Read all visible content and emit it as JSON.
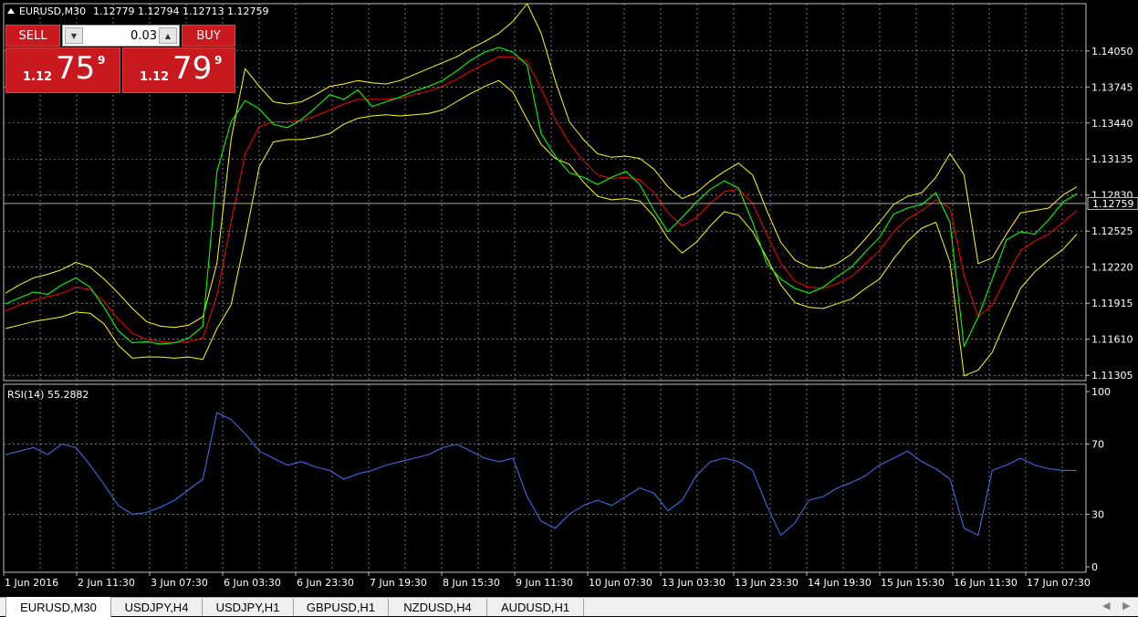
{
  "window": {
    "symbol_header": "EURUSD,M30",
    "ohlc": "1.12779 1.12794 1.12713 1.12759",
    "current_price": "1.12759"
  },
  "one_click": {
    "sell_label": "SELL",
    "buy_label": "BUY",
    "volume": "0.03",
    "sell_prefix": "1.12",
    "sell_big": "75",
    "sell_sup": "9",
    "buy_prefix": "1.12",
    "buy_big": "79",
    "buy_sup": "9"
  },
  "indicator": {
    "label": "RSI(14) 55.2882"
  },
  "tabs": [
    {
      "label": "EURUSD,M30",
      "active": true
    },
    {
      "label": "USDJPY,H4",
      "active": false
    },
    {
      "label": "USDJPY,H1",
      "active": false
    },
    {
      "label": "GBPUSD,H1",
      "active": false
    },
    {
      "label": "NZDUSD,H4",
      "active": false
    },
    {
      "label": "AUDUSD,H1",
      "active": false
    }
  ],
  "colors": {
    "background": "#000000",
    "grid": "#c0c0c0",
    "price_line": "#00ff00",
    "moving_average": "#ff0000",
    "bands": "#ffff00",
    "rsi": "#4169e1",
    "text": "#ffffff",
    "sell_buy_panel": "#c8191f"
  },
  "chart_data": [
    {
      "type": "line",
      "title": "EURUSD,M30",
      "y_ticks": [
        "1.14050",
        "1.13745",
        "1.13440",
        "1.13135",
        "1.12830",
        "1.12525",
        "1.12220",
        "1.11915",
        "1.11610",
        "1.11305"
      ],
      "ylim": [
        1.1126,
        1.1445
      ],
      "x_ticks": [
        "1 Jun 2016",
        "2 Jun 11:30",
        "3 Jun 07:30",
        "6 Jun 03:30",
        "6 Jun 23:30",
        "7 Jun 19:30",
        "8 Jun 15:30",
        "9 Jun 11:30",
        "10 Jun 07:30",
        "13 Jun 03:30",
        "13 Jun 23:30",
        "14 Jun 19:30",
        "15 Jun 15:30",
        "16 Jun 11:30",
        "17 Jun 07:30"
      ],
      "current_price": 1.12759,
      "series": [
        {
          "values": [
            1.1191,
            1.1196,
            1.1201,
            1.1199,
            1.1207,
            1.1213,
            1.1205,
            1.1188,
            1.1168,
            1.1158,
            1.1159,
            1.1157,
            1.1158,
            1.1162,
            1.1172,
            1.1303,
            1.1345,
            1.1363,
            1.1356,
            1.1343,
            1.134,
            1.1347,
            1.1357,
            1.1368,
            1.1364,
            1.1372,
            1.1358,
            1.1362,
            1.1366,
            1.1371,
            1.1375,
            1.138,
            1.1388,
            1.1397,
            1.1404,
            1.1408,
            1.1404,
            1.1393,
            1.1335,
            1.1316,
            1.1302,
            1.1298,
            1.1292,
            1.1298,
            1.1303,
            1.1292,
            1.127,
            1.1252,
            1.1264,
            1.1277,
            1.1288,
            1.1295,
            1.1289,
            1.126,
            1.1225,
            1.1212,
            1.1204,
            1.12,
            1.1205,
            1.1214,
            1.1222,
            1.1235,
            1.1247,
            1.1267,
            1.1272,
            1.1275,
            1.1285,
            1.126,
            1.1155,
            1.118,
            1.1212,
            1.1245,
            1.1252,
            1.125,
            1.1262,
            1.1277,
            1.1284
          ]
        },
        {
          "values": [
            1.1185,
            1.119,
            1.1194,
            1.1197,
            1.12,
            1.1205,
            1.1203,
            1.1193,
            1.1178,
            1.1166,
            1.1161,
            1.1159,
            1.1158,
            1.1159,
            1.1162,
            1.1198,
            1.126,
            1.1318,
            1.1341,
            1.1345,
            1.1345,
            1.1346,
            1.135,
            1.1355,
            1.136,
            1.1364,
            1.1364,
            1.1364,
            1.1365,
            1.1368,
            1.1371,
            1.1375,
            1.1381,
            1.1388,
            1.1394,
            1.14,
            1.14,
            1.1396,
            1.1373,
            1.1347,
            1.1327,
            1.1312,
            1.13,
            1.1297,
            1.1298,
            1.1296,
            1.1285,
            1.1268,
            1.1257,
            1.1264,
            1.1276,
            1.1286,
            1.1288,
            1.1276,
            1.125,
            1.1225,
            1.121,
            1.1205,
            1.1204,
            1.1208,
            1.1214,
            1.1225,
            1.1236,
            1.1252,
            1.1263,
            1.127,
            1.1279,
            1.1272,
            1.1215,
            1.118,
            1.119,
            1.1214,
            1.1236,
            1.1244,
            1.125,
            1.126,
            1.127
          ]
        },
        {
          "values": [
            1.12,
            1.1207,
            1.1213,
            1.1216,
            1.122,
            1.1226,
            1.1222,
            1.1212,
            1.12,
            1.1187,
            1.1176,
            1.1172,
            1.1171,
            1.1173,
            1.118,
            1.1225,
            1.133,
            1.139,
            1.1375,
            1.1362,
            1.136,
            1.1362,
            1.1368,
            1.1375,
            1.1377,
            1.138,
            1.1378,
            1.1377,
            1.138,
            1.1385,
            1.139,
            1.1395,
            1.14,
            1.1407,
            1.1413,
            1.142,
            1.143,
            1.1445,
            1.142,
            1.138,
            1.1345,
            1.133,
            1.1318,
            1.1315,
            1.1316,
            1.1314,
            1.1305,
            1.129,
            1.128,
            1.1285,
            1.1295,
            1.1303,
            1.131,
            1.13,
            1.127,
            1.1243,
            1.1228,
            1.1222,
            1.1221,
            1.1225,
            1.1233,
            1.1246,
            1.126,
            1.1275,
            1.1282,
            1.1285,
            1.1298,
            1.1318,
            1.13,
            1.1225,
            1.123,
            1.125,
            1.1268,
            1.127,
            1.1272,
            1.1283,
            1.129
          ]
        },
        {
          "values": [
            1.117,
            1.1173,
            1.1176,
            1.1178,
            1.118,
            1.1184,
            1.1183,
            1.1174,
            1.1156,
            1.1145,
            1.1146,
            1.1146,
            1.1145,
            1.1146,
            1.1144,
            1.117,
            1.119,
            1.1246,
            1.1307,
            1.1328,
            1.133,
            1.133,
            1.1332,
            1.1335,
            1.1343,
            1.1348,
            1.135,
            1.1351,
            1.135,
            1.1351,
            1.1352,
            1.1355,
            1.1362,
            1.1369,
            1.1375,
            1.138,
            1.137,
            1.1347,
            1.1326,
            1.1314,
            1.1309,
            1.1294,
            1.1282,
            1.1279,
            1.128,
            1.1278,
            1.1265,
            1.1246,
            1.1234,
            1.1243,
            1.1257,
            1.1269,
            1.1266,
            1.1252,
            1.123,
            1.1207,
            1.1192,
            1.1188,
            1.1187,
            1.1191,
            1.1195,
            1.1204,
            1.1212,
            1.1229,
            1.1244,
            1.1255,
            1.126,
            1.1226,
            1.113,
            1.1135,
            1.115,
            1.1178,
            1.1204,
            1.1218,
            1.1228,
            1.1237,
            1.125
          ]
        }
      ]
    },
    {
      "type": "line",
      "title": "RSI(14) 55.2882",
      "y_ticks": [
        "100",
        "70",
        "30",
        "0"
      ],
      "ylim": [
        0,
        100
      ],
      "x_ticks": [
        "1 Jun 2016",
        "2 Jun 11:30",
        "3 Jun 07:30",
        "6 Jun 03:30",
        "6 Jun 23:30",
        "7 Jun 19:30",
        "8 Jun 15:30",
        "9 Jun 11:30",
        "10 Jun 07:30",
        "13 Jun 03:30",
        "13 Jun 23:30",
        "14 Jun 19:30",
        "15 Jun 15:30",
        "16 Jun 11:30",
        "17 Jun 07:30"
      ],
      "series": [
        {
          "values": [
            64,
            66,
            68,
            64,
            70,
            68,
            58,
            47,
            35,
            30,
            31,
            34,
            38,
            44,
            50,
            88,
            84,
            76,
            66,
            62,
            58,
            60,
            57,
            55,
            50,
            53,
            55,
            58,
            60,
            62,
            64,
            68,
            70,
            66,
            62,
            60,
            62,
            40,
            26,
            22,
            30,
            35,
            38,
            35,
            40,
            45,
            42,
            32,
            38,
            52,
            60,
            62,
            60,
            55,
            35,
            18,
            25,
            38,
            40,
            45,
            48,
            52,
            58,
            62,
            66,
            60,
            56,
            50,
            22,
            18,
            55,
            58,
            62,
            58,
            56,
            55,
            55
          ]
        }
      ]
    }
  ]
}
